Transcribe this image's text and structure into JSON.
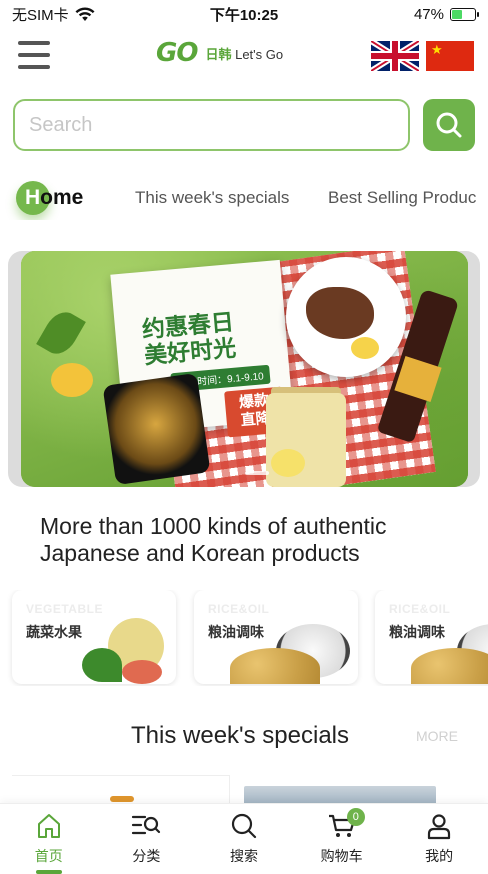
{
  "status_bar": {
    "carrier": "无SIM卡",
    "time": "下午10:25",
    "battery": "47%",
    "battery_level": 0.47
  },
  "header": {
    "logo_mark": "GO",
    "logo_text_cn": "日韩",
    "logo_text_en": "Let's Go",
    "flags": [
      "uk-flag-icon",
      "china-flag-icon"
    ]
  },
  "search": {
    "placeholder": "Search"
  },
  "tabs": [
    {
      "label_first": "H",
      "label_rest": "ome"
    },
    {
      "label": "This week's specials"
    },
    {
      "label": "Best Selling Produc"
    }
  ],
  "banner": {
    "title": "约惠春日\n美好时光",
    "date": "活动时间：9.1-9.10",
    "badge": "爆款\n直降"
  },
  "headline": "More than 1000 kinds of authentic Japanese and Korean products",
  "categories": [
    {
      "en": "VEGETABLE",
      "cn": "蔬菜水果"
    },
    {
      "en": "RICE&OIL",
      "cn": "粮油调味"
    },
    {
      "en": "RICE&OIL",
      "cn": "粮油调味"
    }
  ],
  "specials": {
    "title": "This week's specials",
    "more": "MORE"
  },
  "tabbar": [
    {
      "label": "首页",
      "icon": "home-icon"
    },
    {
      "label": "分类",
      "icon": "category-search-icon"
    },
    {
      "label": "搜索",
      "icon": "search-icon"
    },
    {
      "label": "购物车",
      "icon": "cart-icon",
      "badge": "0"
    },
    {
      "label": "我的",
      "icon": "user-icon"
    }
  ],
  "colors": {
    "accent": "#6fb34b",
    "text": "#222222",
    "muted": "#d0d0d0"
  }
}
